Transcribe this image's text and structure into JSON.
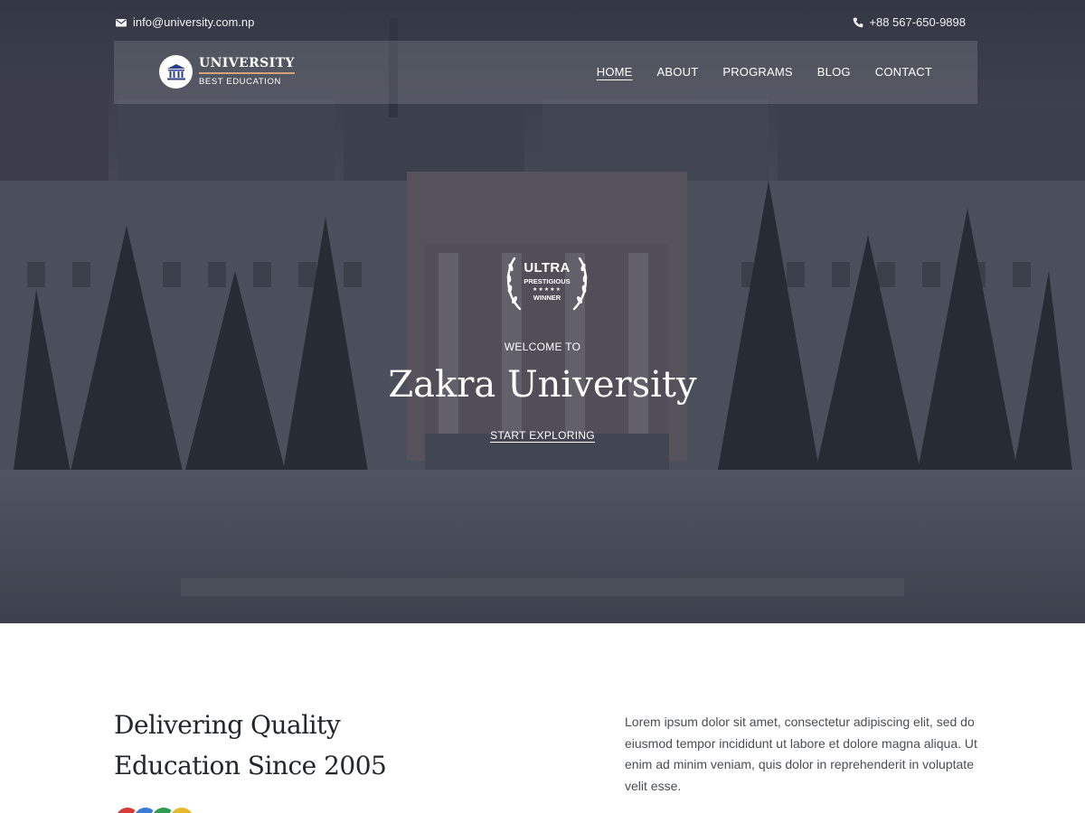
{
  "topbar": {
    "email": "info@university.com.np",
    "phone": "+88 567-650-9898",
    "email_icon": "envelope-icon",
    "phone_icon": "phone-icon"
  },
  "logo": {
    "title": "UNIVERSITY",
    "subtitle": "BEST EDUCATION",
    "icon": "university-building-icon"
  },
  "nav": {
    "items": [
      {
        "label": "HOME",
        "active": true
      },
      {
        "label": "ABOUT",
        "active": false
      },
      {
        "label": "PROGRAMS",
        "active": false
      },
      {
        "label": "BLOG",
        "active": false
      },
      {
        "label": "CONTACT",
        "active": false
      }
    ]
  },
  "hero": {
    "badge": {
      "line1": "ULTRA",
      "line2": "PRESTIGIOUS",
      "stars": "★★★★★",
      "line3": "WINNER"
    },
    "welcome": "WELCOME TO",
    "title": "Zakra University",
    "cta": "START EXPLORING"
  },
  "about": {
    "title_line1": "Delivering Quality",
    "title_line2": "Education Since 2005",
    "text": "Lorem ipsum dolor sit amet, consectetur adipiscing elit, sed do eiusmod tempor incididunt ut labore et dolore magna aliqua. Ut enim ad minim veniam, quis dolor in reprehenderit in voluptate velit esse.",
    "avatar_colors": [
      "#d83a3a",
      "#3a7bd5",
      "#2e9d4f",
      "#e8b82a"
    ]
  },
  "colors": {
    "accent": "#d5a27a",
    "logo_blue": "#2a3f87"
  }
}
